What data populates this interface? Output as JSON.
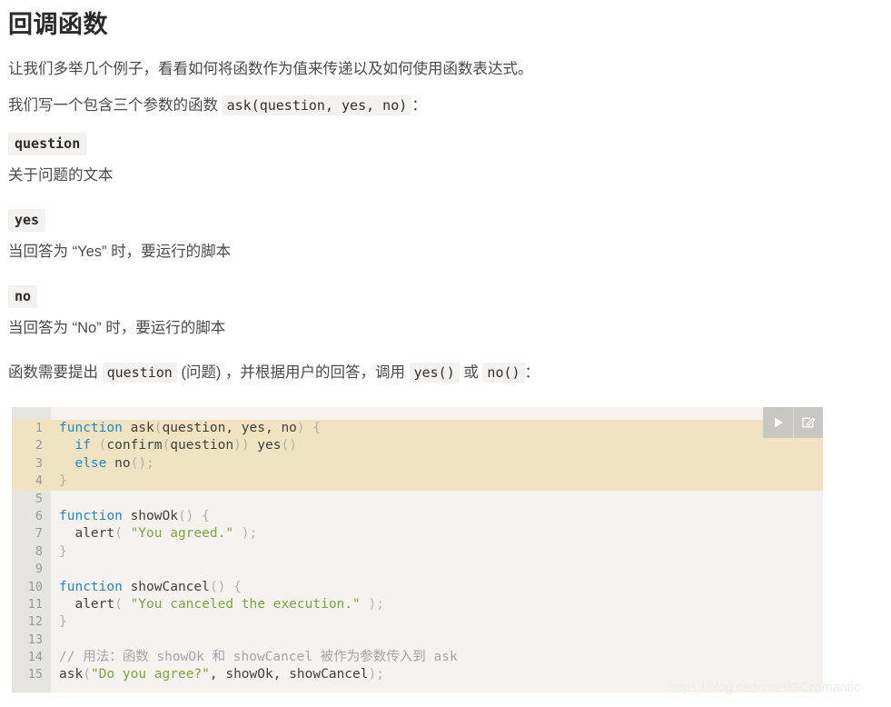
{
  "document": {
    "title": "回调函数",
    "intro": "让我们多举几个例子，看看如何将函数作为值来传递以及如何使用函数表达式。",
    "signature_prefix": "我们写一个包含三个参数的函数 ",
    "signature_code": "ask(question, yes, no)",
    "signature_suffix": "：",
    "params": [
      {
        "name": "question",
        "description": "关于问题的文本"
      },
      {
        "name": "yes",
        "description": "当回答为 “Yes” 时，要运行的脚本"
      },
      {
        "name": "no",
        "description": "当回答为 “No” 时，要运行的脚本"
      }
    ],
    "call_sentence": {
      "p1": "函数需要提出 ",
      "c1": "question",
      "p2": " (问题) ，并根据用户的回答，调用 ",
      "c2": "yes()",
      "p3": " 或 ",
      "c3": "no()",
      "p4": "："
    }
  },
  "code_block": {
    "language": "javascript",
    "highlighted_lines": [
      1,
      2,
      3,
      4
    ],
    "toolbar": {
      "run_label": "run-code",
      "edit_label": "edit-code"
    },
    "lines": [
      {
        "n": "1",
        "tokens": [
          {
            "t": "function",
            "c": "t-kw"
          },
          {
            "t": " ask",
            "c": "t-fn"
          },
          {
            "t": "(",
            "c": "t-pun"
          },
          {
            "t": "question, yes, no",
            "c": "t-plain"
          },
          {
            "t": ") {",
            "c": "t-pun"
          }
        ]
      },
      {
        "n": "2",
        "tokens": [
          {
            "t": "  ",
            "c": "t-plain"
          },
          {
            "t": "if",
            "c": "t-kw"
          },
          {
            "t": " ",
            "c": "t-plain"
          },
          {
            "t": "(",
            "c": "t-pun"
          },
          {
            "t": "confirm",
            "c": "t-plain"
          },
          {
            "t": "(",
            "c": "t-pun"
          },
          {
            "t": "question",
            "c": "t-plain"
          },
          {
            "t": "))",
            "c": "t-pun"
          },
          {
            "t": " yes",
            "c": "t-plain"
          },
          {
            "t": "()",
            "c": "t-pun"
          }
        ]
      },
      {
        "n": "3",
        "tokens": [
          {
            "t": "  ",
            "c": "t-plain"
          },
          {
            "t": "else",
            "c": "t-kw"
          },
          {
            "t": " no",
            "c": "t-plain"
          },
          {
            "t": "();",
            "c": "t-pun"
          }
        ]
      },
      {
        "n": "4",
        "tokens": [
          {
            "t": "}",
            "c": "t-pun"
          }
        ]
      },
      {
        "n": "5",
        "tokens": [
          {
            "t": "",
            "c": "t-plain"
          }
        ]
      },
      {
        "n": "6",
        "tokens": [
          {
            "t": "function",
            "c": "t-kw"
          },
          {
            "t": " showOk",
            "c": "t-fn"
          },
          {
            "t": "() {",
            "c": "t-pun"
          }
        ]
      },
      {
        "n": "7",
        "tokens": [
          {
            "t": "  alert",
            "c": "t-plain"
          },
          {
            "t": "( ",
            "c": "t-pun"
          },
          {
            "t": "\"You agreed.\"",
            "c": "t-str"
          },
          {
            "t": " );",
            "c": "t-pun"
          }
        ]
      },
      {
        "n": "8",
        "tokens": [
          {
            "t": "}",
            "c": "t-pun"
          }
        ]
      },
      {
        "n": "9",
        "tokens": [
          {
            "t": "",
            "c": "t-plain"
          }
        ]
      },
      {
        "n": "10",
        "tokens": [
          {
            "t": "function",
            "c": "t-kw"
          },
          {
            "t": " showCancel",
            "c": "t-fn"
          },
          {
            "t": "() {",
            "c": "t-pun"
          }
        ]
      },
      {
        "n": "11",
        "tokens": [
          {
            "t": "  alert",
            "c": "t-plain"
          },
          {
            "t": "( ",
            "c": "t-pun"
          },
          {
            "t": "\"You canceled the execution.\"",
            "c": "t-str"
          },
          {
            "t": " );",
            "c": "t-pun"
          }
        ]
      },
      {
        "n": "12",
        "tokens": [
          {
            "t": "}",
            "c": "t-pun"
          }
        ]
      },
      {
        "n": "13",
        "tokens": [
          {
            "t": "",
            "c": "t-plain"
          }
        ]
      },
      {
        "n": "14",
        "tokens": [
          {
            "t": "// 用法：函数 showOk 和 showCancel 被作为参数传入到 ask",
            "c": "t-com"
          }
        ]
      },
      {
        "n": "15",
        "tokens": [
          {
            "t": "ask",
            "c": "t-plain"
          },
          {
            "t": "(",
            "c": "t-pun"
          },
          {
            "t": "\"Do you agree?\"",
            "c": "t-str"
          },
          {
            "t": ", showOk, showCancel",
            "c": "t-plain"
          },
          {
            "t": ");",
            "c": "t-pun"
          }
        ]
      }
    ]
  },
  "watermark": {
    "text": "https://blog.csdn.net/GCromantic"
  },
  "colors": {
    "code_background": "#f5f2f0",
    "gutter_background": "#e6e4e1",
    "highlight_background": "#f0e3c2",
    "keyword": "#1e88c7",
    "string": "#7aa63c",
    "comment": "#a3a5a8",
    "punctuation": "#b4b2ae",
    "inline_code_background": "#f4f2f0",
    "toolbar_background": "#c9c7c4"
  }
}
